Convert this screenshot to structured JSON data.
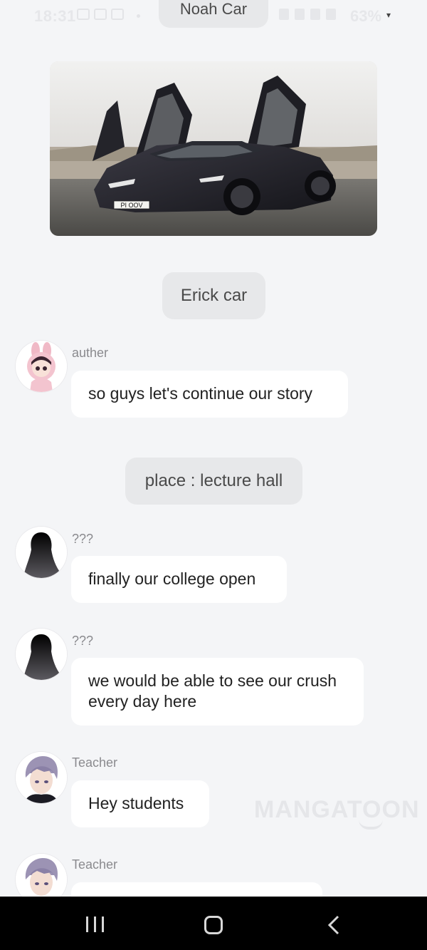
{
  "status_bar": {
    "time": "18:31",
    "battery": "63%"
  },
  "narrations": {
    "top": "Noah Car",
    "erick": "Erick car",
    "place": "place : lecture hall"
  },
  "car_image": {
    "plate": "PI OOV"
  },
  "messages": [
    {
      "sender": "auther",
      "text": "so guys let's continue our story"
    },
    {
      "sender": "???",
      "text": "finally our college open"
    },
    {
      "sender": "???",
      "text": "we would be able to see our crush every day here"
    },
    {
      "sender": "Teacher",
      "text": "Hey students"
    },
    {
      "sender": "Teacher",
      "text": ""
    }
  ],
  "watermark": "MANGATOON",
  "colors": {
    "background": "#f4f5f7",
    "bubble": "#ffffff",
    "narration_bg": "#e7e8ea",
    "nav_bar": "#000000"
  }
}
